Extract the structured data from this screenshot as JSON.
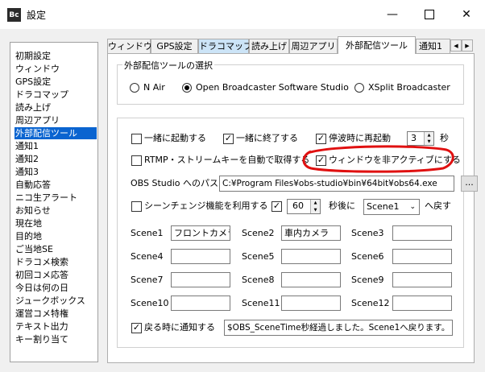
{
  "window": {
    "app_icon": "Bc",
    "title": "設定",
    "minimize_icon": "minimize-icon",
    "maximize_icon": "maximize-icon",
    "close_icon": "close-icon"
  },
  "sidebar": {
    "items": [
      "初期設定",
      "ウィンドウ",
      "GPS設定",
      "ドラコマップ",
      "読み上げ",
      "周辺アプリ",
      "外部配信ツール",
      "通知1",
      "通知2",
      "通知3",
      "自動応答",
      "ニコ生アラート",
      "お知らせ",
      "現在地",
      "目的地",
      "ご当地SE",
      "ドラコメ検索",
      "初回コメ応答",
      "今日は何の日",
      "ジュークボックス",
      "運営コメ特権",
      "テキスト出力",
      "キー割り当て"
    ],
    "selected_index": 6
  },
  "tabs": {
    "items": [
      "ウィンドウ",
      "GPS設定",
      "ドラコマップ",
      "読み上げ",
      "周辺アプリ",
      "外部配信ツール",
      "通知1"
    ],
    "selected_index": 5,
    "hover_index": 2,
    "scroll_left": "◀",
    "scroll_right": "▶"
  },
  "tool_select": {
    "legend": "外部配信ツールの選択",
    "options": [
      "N Air",
      "Open Broadcaster Software Studio",
      "XSplit Broadcaster"
    ],
    "selected_index": 1
  },
  "options": {
    "start_together": {
      "label": "一緒に起動する",
      "checked": false
    },
    "exit_together": {
      "label": "一緒に終了する",
      "checked": true
    },
    "restart_on_stop": {
      "label": "停波時に再起動",
      "checked": true
    },
    "restart_seconds": "3",
    "seconds_unit": "秒",
    "auto_stream_key": {
      "label": "RTMP・ストリームキーを自動で取得する",
      "checked": false
    },
    "deactivate_window": {
      "label": "ウィンドウを非アクティブにする",
      "checked": true
    },
    "obs_path_label": "OBS Studio へのパス",
    "obs_path_value": "C:¥Program Files¥obs-studio¥bin¥64bit¥obs64.exe",
    "browse_button": "...",
    "scene_change": {
      "label": "シーンチェンジ機能を利用する",
      "checked": false
    },
    "scene_delay_checked": true,
    "scene_delay_value": "60",
    "scene_after_label": "秒後に",
    "scene_return_target": "Scene1",
    "scene_return_label": "へ戻す",
    "scenes": [
      {
        "label": "Scene1",
        "value": "フロントカメラ"
      },
      {
        "label": "Scene2",
        "value": "車内カメラ"
      },
      {
        "label": "Scene3",
        "value": ""
      },
      {
        "label": "Scene4",
        "value": ""
      },
      {
        "label": "Scene5",
        "value": ""
      },
      {
        "label": "Scene6",
        "value": ""
      },
      {
        "label": "Scene7",
        "value": ""
      },
      {
        "label": "Scene8",
        "value": ""
      },
      {
        "label": "Scene9",
        "value": ""
      },
      {
        "label": "Scene10",
        "value": ""
      },
      {
        "label": "Scene11",
        "value": ""
      },
      {
        "label": "Scene12",
        "value": ""
      }
    ],
    "notify_on_return": {
      "label": "戻る時に通知する",
      "checked": true
    },
    "notify_message": "$OBS_SceneTime秒経過しました。Scene1へ戻ります。"
  },
  "colors": {
    "selection": "#0a64d0",
    "annotation": "#e01010"
  }
}
